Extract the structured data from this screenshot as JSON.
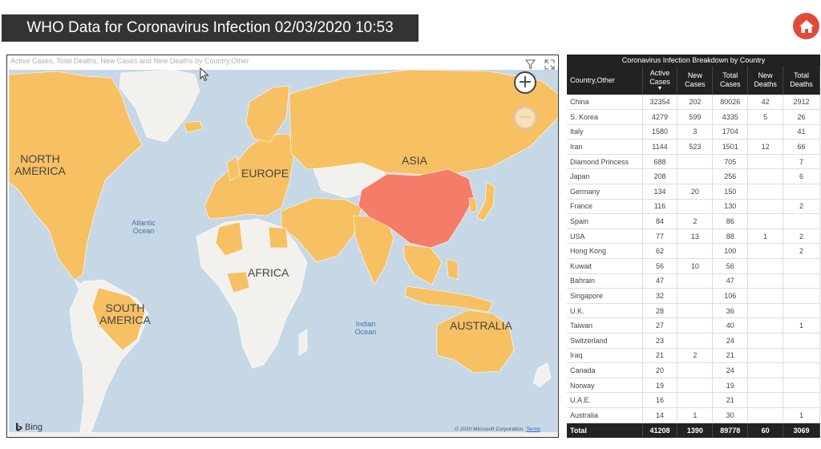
{
  "header": {
    "title": "WHO Data for Coronavirus Infection 02/03/2020 10:53"
  },
  "home_button": {
    "icon": "home-icon",
    "color": "#e04a3a"
  },
  "map": {
    "caption": "Active Cases, Total Deaths, New Cases and New Deaths by Country,Other",
    "tools": [
      "filter-icon",
      "focus-mode-icon"
    ],
    "regions": [
      "NORTH AMERICA",
      "EUROPE",
      "ASIA",
      "AFRICA",
      "SOUTH AMERICA",
      "AUSTRALIA"
    ],
    "oceans": [
      "Atlantic Ocean",
      "Indian Ocean"
    ],
    "zoom_in": "+",
    "zoom_out": "−",
    "provider": "Bing",
    "copyright": "© 2020 Microsoft Corporation",
    "terms": "Terms",
    "colors": {
      "ocean": "#c6d8e6",
      "affected": "#f7c063",
      "highlight": "#f47c68",
      "unaffected": "#f3f1ee"
    }
  },
  "table": {
    "title": "Coronavirus Infection Breakdown by Country",
    "headers": [
      "Country,Other",
      "Active Cases",
      "New Cases",
      "Total Cases",
      "New Deaths",
      "Total Deaths"
    ],
    "sorted_column": "Active Cases",
    "rows": [
      [
        "China",
        "32354",
        "202",
        "80026",
        "42",
        "2912"
      ],
      [
        "S. Korea",
        "4279",
        "599",
        "4335",
        "5",
        "26"
      ],
      [
        "Italy",
        "1580",
        "3",
        "1704",
        "",
        "41"
      ],
      [
        "Iran",
        "1144",
        "523",
        "1501",
        "12",
        "66"
      ],
      [
        "Diamond Princess",
        "688",
        "",
        "705",
        "",
        "7"
      ],
      [
        "Japan",
        "208",
        "",
        "256",
        "",
        "6"
      ],
      [
        "Germany",
        "134",
        "20",
        "150",
        "",
        ""
      ],
      [
        "France",
        "116",
        "",
        "130",
        "",
        "2"
      ],
      [
        "Spain",
        "84",
        "2",
        "86",
        "",
        ""
      ],
      [
        "USA",
        "77",
        "13",
        "88",
        "1",
        "2"
      ],
      [
        "Hong Kong",
        "62",
        "",
        "100",
        "",
        "2"
      ],
      [
        "Kuwait",
        "56",
        "10",
        "56",
        "",
        ""
      ],
      [
        "Bahrain",
        "47",
        "",
        "47",
        "",
        ""
      ],
      [
        "Singapore",
        "32",
        "",
        "106",
        "",
        ""
      ],
      [
        "U.K.",
        "28",
        "",
        "36",
        "",
        ""
      ],
      [
        "Taiwan",
        "27",
        "",
        "40",
        "",
        "1"
      ],
      [
        "Switzerland",
        "23",
        "",
        "24",
        "",
        ""
      ],
      [
        "Iraq",
        "21",
        "2",
        "21",
        "",
        ""
      ],
      [
        "Canada",
        "20",
        "",
        "24",
        "",
        ""
      ],
      [
        "Norway",
        "19",
        "",
        "19",
        "",
        ""
      ],
      [
        "U.A.E.",
        "16",
        "",
        "21",
        "",
        ""
      ],
      [
        "Australia",
        "14",
        "1",
        "30",
        "",
        "1"
      ]
    ],
    "total": [
      "Total",
      "41208",
      "1390",
      "89778",
      "60",
      "3069"
    ]
  }
}
